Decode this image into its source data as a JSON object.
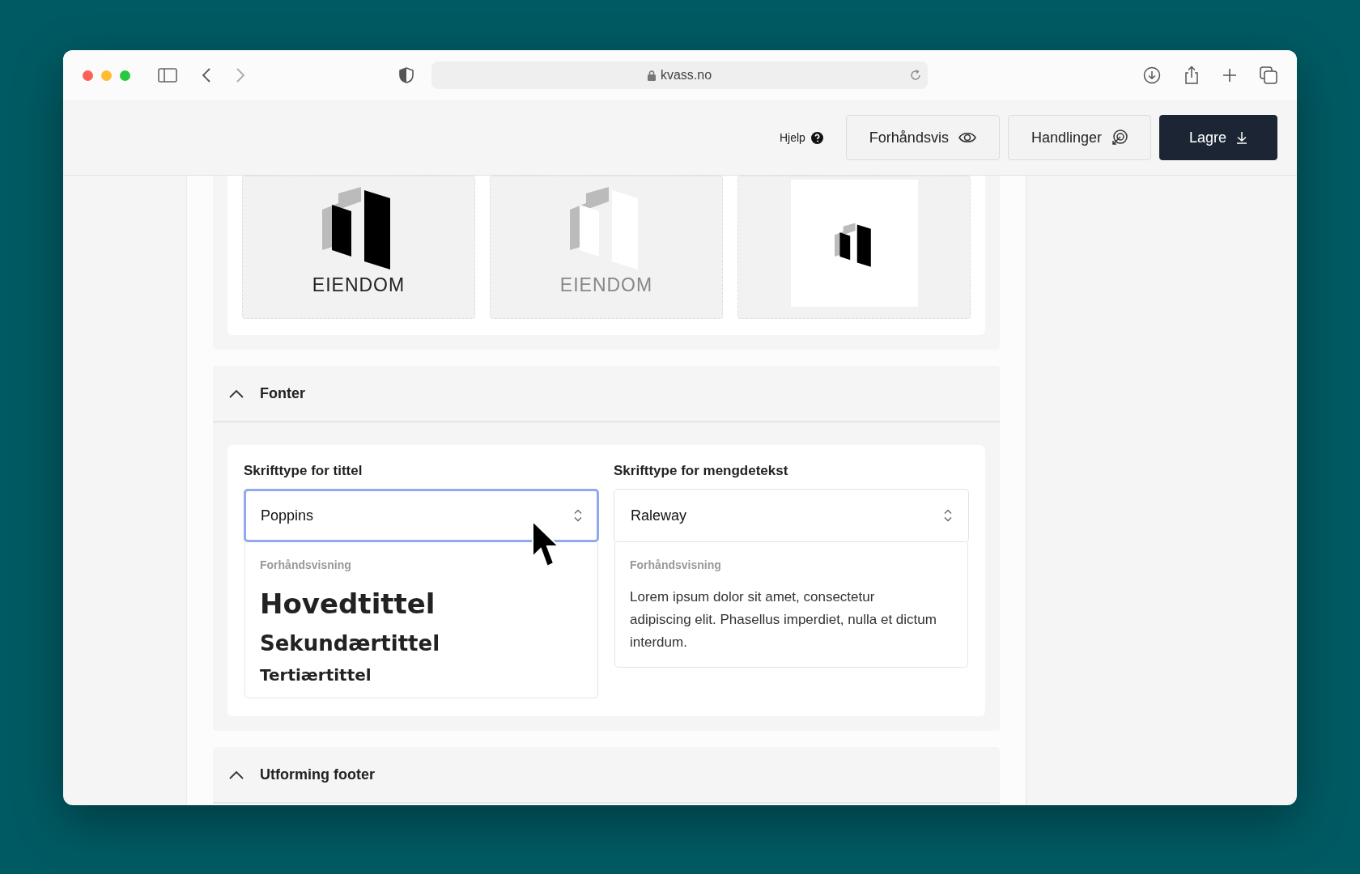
{
  "browser": {
    "url": "kvass.no"
  },
  "toolbar": {
    "help": "Hjelp",
    "buttons": [
      {
        "label": "Forhåndsvis",
        "kind": "eye"
      },
      {
        "label": "Handlinger",
        "kind": "actions"
      },
      {
        "label": "Lagre",
        "kind": "save"
      }
    ]
  },
  "logos": [
    {
      "kind": "dark",
      "text": "EIENDOM"
    },
    {
      "kind": "light",
      "text": "EIENDOM"
    },
    {
      "kind": "icon"
    }
  ],
  "sections": [
    {
      "title": "Fonter",
      "expanded": true,
      "fields": [
        {
          "label": "Skrifttype for tittel",
          "value": "Poppins",
          "focused": true,
          "preview_label": "Forhåndsvisning",
          "kind": "headings",
          "samples": [
            "Hovedtittel",
            "Sekundærtittel",
            "Tertiærtittel"
          ]
        },
        {
          "label": "Skrifttype for mengdetekst",
          "value": "Raleway",
          "focused": false,
          "preview_label": "Forhåndsvisning",
          "kind": "body",
          "samples": [
            "Lorem ipsum dolor sit amet, consectetur adipiscing elit. Phasellus imperdiet, nulla et dictum interdum."
          ]
        }
      ]
    },
    {
      "title": "Utforming footer",
      "expanded": true
    }
  ]
}
